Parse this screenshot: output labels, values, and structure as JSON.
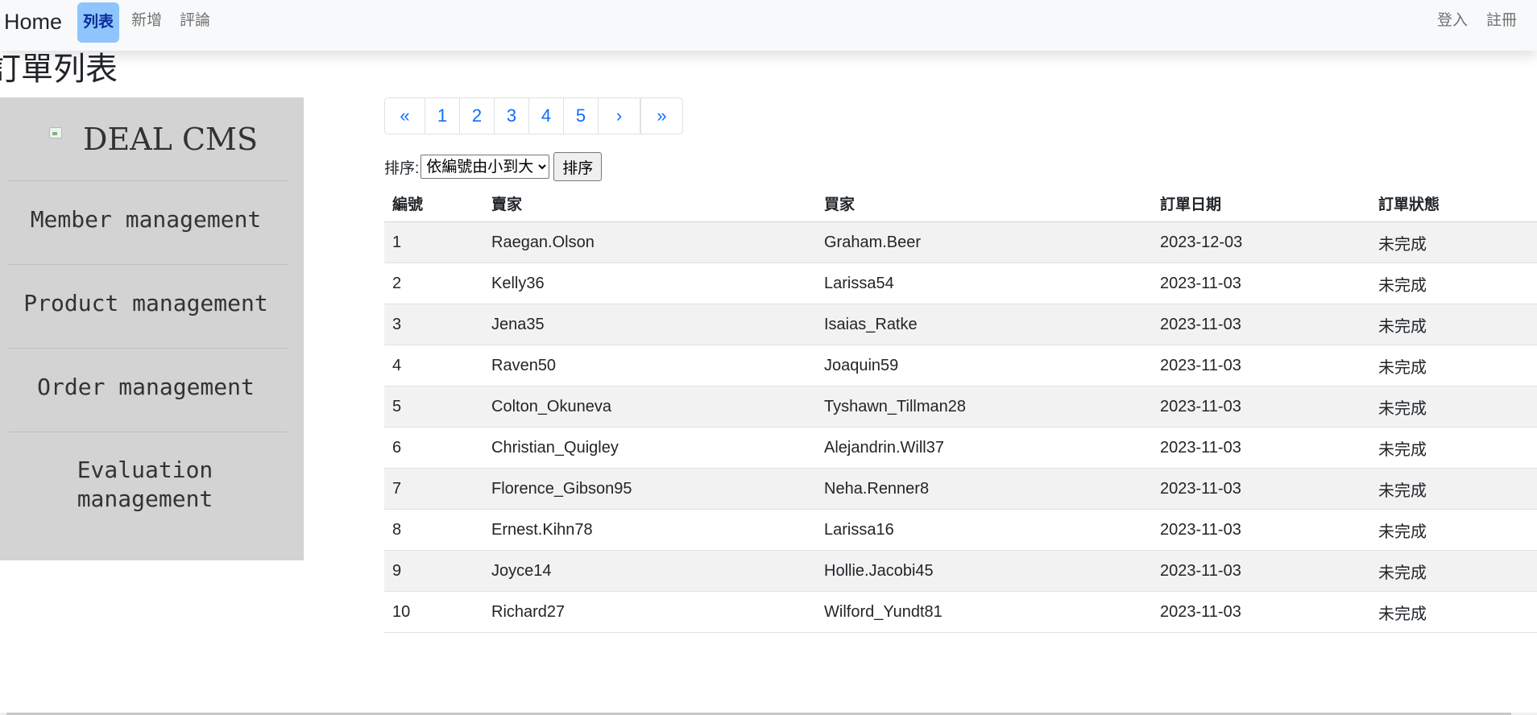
{
  "navbar": {
    "brand": "Home",
    "links": [
      {
        "label": "列表",
        "active": true
      },
      {
        "label": "新增",
        "active": false
      },
      {
        "label": "評論",
        "active": false
      }
    ],
    "right_links": [
      "登入",
      "註冊"
    ]
  },
  "page_title": "訂單列表",
  "sidebar": {
    "brand": "DEAL CMS",
    "items": [
      {
        "label": "Member management"
      },
      {
        "label": "Product management"
      },
      {
        "label": "Order management"
      },
      {
        "label": "Evaluation management"
      }
    ]
  },
  "pagination": {
    "first": "«",
    "pages": [
      "1",
      "2",
      "3",
      "4",
      "5"
    ],
    "next": "›",
    "last": "»"
  },
  "sort": {
    "label": "排序:",
    "selected": "依編號由小到大",
    "button": "排序"
  },
  "table": {
    "headers": [
      "編號",
      "賣家",
      "買家",
      "訂單日期",
      "訂單狀態"
    ],
    "rows": [
      [
        "1",
        "Raegan.Olson",
        "Graham.Beer",
        "2023-12-03",
        "未完成"
      ],
      [
        "2",
        "Kelly36",
        "Larissa54",
        "2023-11-03",
        "未完成"
      ],
      [
        "3",
        "Jena35",
        "Isaias_Ratke",
        "2023-11-03",
        "未完成"
      ],
      [
        "4",
        "Raven50",
        "Joaquin59",
        "2023-11-03",
        "未完成"
      ],
      [
        "5",
        "Colton_Okuneva",
        "Tyshawn_Tillman28",
        "2023-11-03",
        "未完成"
      ],
      [
        "6",
        "Christian_Quigley",
        "Alejandrin.Will37",
        "2023-11-03",
        "未完成"
      ],
      [
        "7",
        "Florence_Gibson95",
        "Neha.Renner8",
        "2023-11-03",
        "未完成"
      ],
      [
        "8",
        "Ernest.Kihn78",
        "Larissa16",
        "2023-11-03",
        "未完成"
      ],
      [
        "9",
        "Joyce14",
        "Hollie.Jacobi45",
        "2023-11-03",
        "未完成"
      ],
      [
        "10",
        "Richard27",
        "Wilford_Yundt81",
        "2023-11-03",
        "未完成"
      ]
    ]
  },
  "colors": {
    "navbar_bg": "#f8f9fa",
    "active_link_bg": "#8ec5fc",
    "link_blue": "#0d6efd",
    "sidebar_bg": "#d3d3d3",
    "stripe": "#f2f2f2"
  }
}
